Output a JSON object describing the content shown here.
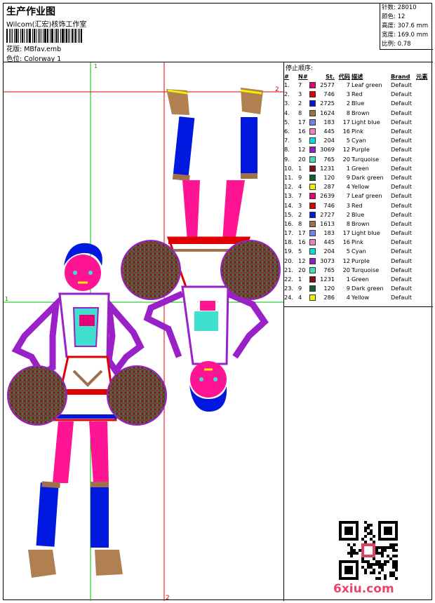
{
  "header": {
    "title": "生产作业图",
    "company": "Wilcom(汇宏)核饰工作室",
    "pattern": "花版: MBfav.emb",
    "colorway": "色位: Colorway 1"
  },
  "stats": [
    {
      "label": "针数",
      "value": "28010"
    },
    {
      "label": "颜色",
      "value": "12"
    },
    {
      "label": "高度",
      "value": "307.6 mm"
    },
    {
      "label": "宽度",
      "value": "169.0 mm"
    },
    {
      "label": "比例",
      "value": "0.78"
    }
  ],
  "guides": {
    "v1": "1",
    "v2": "2",
    "h1": "1",
    "h2": "2"
  },
  "stop_sequence": {
    "heading": "停止顺序:",
    "columns": {
      "idx": "#",
      "num": "N#",
      "stitches": "St.",
      "code": "代码",
      "desc": "描述",
      "brand": "Brand",
      "element": "元素"
    },
    "rows": [
      {
        "idx": "1.",
        "num": "7",
        "color": "#e8007a",
        "stitches": "2577",
        "code": "7",
        "desc": "Leaf green",
        "brand": "Default"
      },
      {
        "idx": "2.",
        "num": "3",
        "color": "#e00000",
        "stitches": "746",
        "code": "3",
        "desc": "Red",
        "brand": "Default"
      },
      {
        "idx": "3.",
        "num": "2",
        "color": "#0018e0",
        "stitches": "2725",
        "code": "2",
        "desc": "Blue",
        "brand": "Default"
      },
      {
        "idx": "4.",
        "num": "8",
        "color": "#a0704a",
        "stitches": "1624",
        "code": "8",
        "desc": "Brown",
        "brand": "Default"
      },
      {
        "idx": "5.",
        "num": "17",
        "color": "#7080e8",
        "stitches": "183",
        "code": "17",
        "desc": "Light blue",
        "brand": "Default"
      },
      {
        "idx": "6.",
        "num": "16",
        "color": "#f080c0",
        "stitches": "445",
        "code": "16",
        "desc": "Pink",
        "brand": "Default"
      },
      {
        "idx": "7.",
        "num": "5",
        "color": "#00e0e0",
        "stitches": "204",
        "code": "5",
        "desc": "Cyan",
        "brand": "Default"
      },
      {
        "idx": "8.",
        "num": "12",
        "color": "#9020c0",
        "stitches": "3069",
        "code": "12",
        "desc": "Purple",
        "brand": "Default"
      },
      {
        "idx": "9.",
        "num": "20",
        "color": "#40e0b0",
        "stitches": "765",
        "code": "20",
        "desc": "Turquoise",
        "brand": "Default"
      },
      {
        "idx": "10.",
        "num": "1",
        "color": "#801010",
        "stitches": "1231",
        "code": "1",
        "desc": "Green",
        "brand": "Default"
      },
      {
        "idx": "11.",
        "num": "9",
        "color": "#106030",
        "stitches": "120",
        "code": "9",
        "desc": "Dark green",
        "brand": "Default"
      },
      {
        "idx": "12.",
        "num": "4",
        "color": "#f0f000",
        "stitches": "287",
        "code": "4",
        "desc": "Yellow",
        "brand": "Default"
      },
      {
        "idx": "13.",
        "num": "7",
        "color": "#e8007a",
        "stitches": "2639",
        "code": "7",
        "desc": "Leaf green",
        "brand": "Default"
      },
      {
        "idx": "14.",
        "num": "3",
        "color": "#e00000",
        "stitches": "746",
        "code": "3",
        "desc": "Red",
        "brand": "Default"
      },
      {
        "idx": "15.",
        "num": "2",
        "color": "#0018e0",
        "stitches": "2727",
        "code": "2",
        "desc": "Blue",
        "brand": "Default"
      },
      {
        "idx": "16.",
        "num": "8",
        "color": "#a0704a",
        "stitches": "1613",
        "code": "8",
        "desc": "Brown",
        "brand": "Default"
      },
      {
        "idx": "17.",
        "num": "17",
        "color": "#7080e8",
        "stitches": "183",
        "code": "17",
        "desc": "Light blue",
        "brand": "Default"
      },
      {
        "idx": "18.",
        "num": "16",
        "color": "#f080c0",
        "stitches": "445",
        "code": "16",
        "desc": "Pink",
        "brand": "Default"
      },
      {
        "idx": "19.",
        "num": "5",
        "color": "#00e0e0",
        "stitches": "204",
        "code": "5",
        "desc": "Cyan",
        "brand": "Default"
      },
      {
        "idx": "20.",
        "num": "12",
        "color": "#9020c0",
        "stitches": "3073",
        "code": "12",
        "desc": "Purple",
        "brand": "Default"
      },
      {
        "idx": "21.",
        "num": "20",
        "color": "#40e0b0",
        "stitches": "765",
        "code": "20",
        "desc": "Turquoise",
        "brand": "Default"
      },
      {
        "idx": "22.",
        "num": "1",
        "color": "#801010",
        "stitches": "1231",
        "code": "1",
        "desc": "Green",
        "brand": "Default"
      },
      {
        "idx": "23.",
        "num": "9",
        "color": "#106030",
        "stitches": "120",
        "code": "9",
        "desc": "Dark green",
        "brand": "Default"
      },
      {
        "idx": "24.",
        "num": "4",
        "color": "#f0f000",
        "stitches": "286",
        "code": "4",
        "desc": "Yellow",
        "brand": "Default"
      }
    ]
  },
  "watermark": "6xiu.com"
}
